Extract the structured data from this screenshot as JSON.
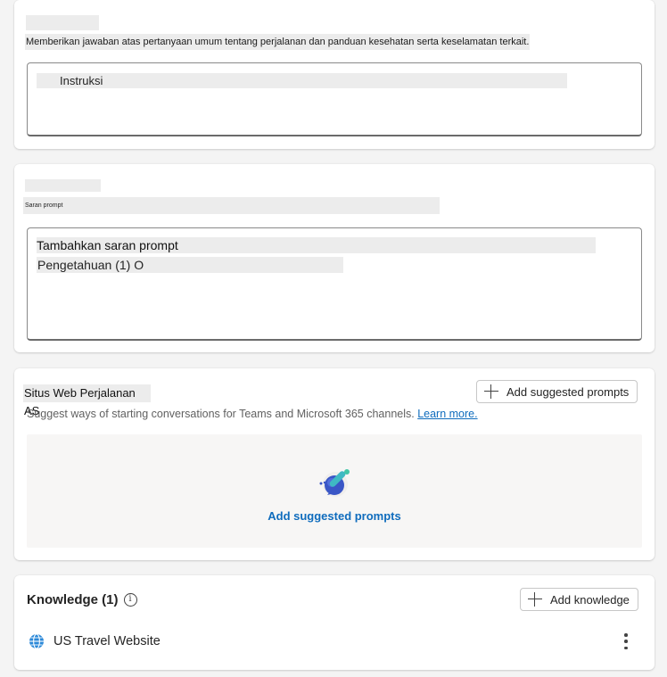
{
  "card1": {
    "title": "",
    "description": "Memberikan jawaban atas pertanyaan umum tentang perjalanan dan panduan kesehatan serta keselamatan terkait.",
    "instructions_label": "Instruksi"
  },
  "card2": {
    "title": "",
    "subtitle": "Saran prompt",
    "line1": "Tambahkan saran prompt",
    "line2": "Pengetahuan (1) O"
  },
  "suggested": {
    "title": "Situs Web Perjalanan AS",
    "add_button_label": "Add suggested prompts",
    "hint_text": "Suggest ways of starting conversations for Teams and Microsoft 365 channels.",
    "learn_more": "Learn more.",
    "empty_action_label": "Add suggested prompts"
  },
  "knowledge": {
    "title": "Knowledge (1)",
    "add_button_label": "Add knowledge",
    "items": [
      {
        "label": "US Travel Website",
        "icon": "globe-icon"
      }
    ]
  },
  "colors": {
    "link": "#0f6cbd",
    "accent_teal": "#3fb9c3",
    "accent_blue": "#3a56c6"
  }
}
